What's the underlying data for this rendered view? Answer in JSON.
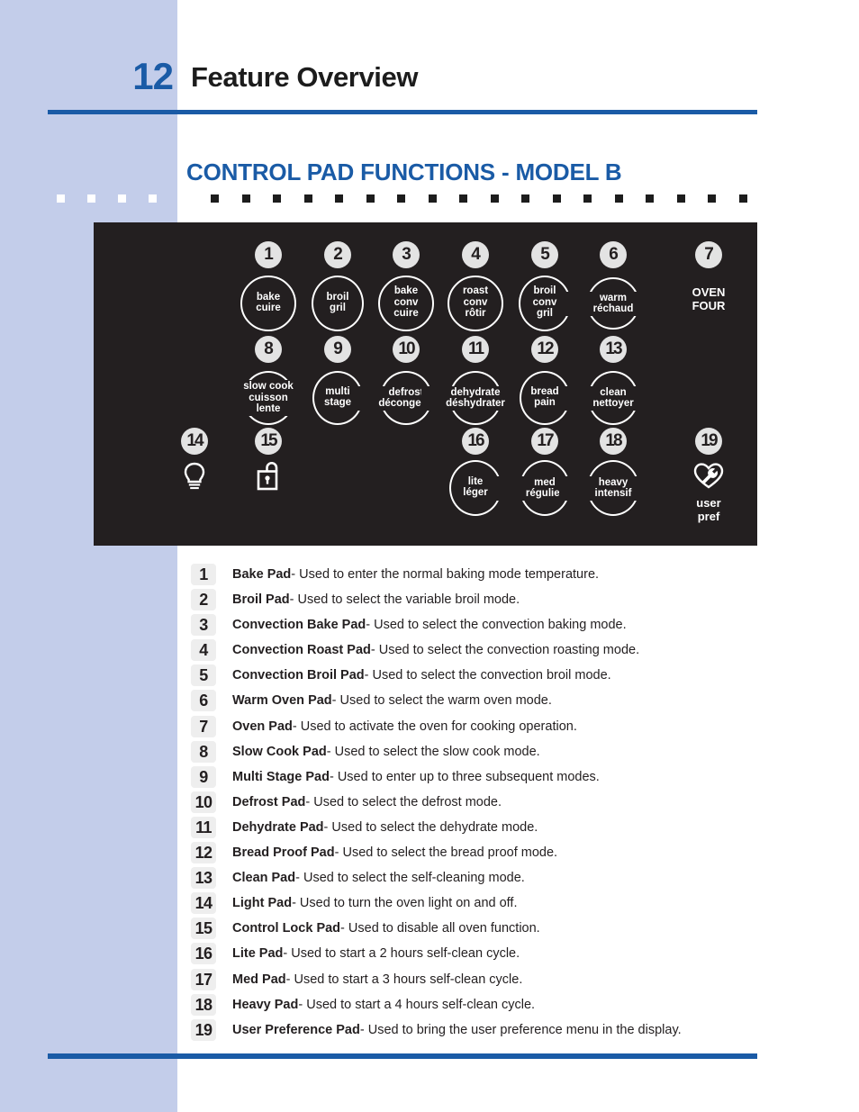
{
  "header": {
    "page_number": "12",
    "title": "Feature Overview"
  },
  "section": {
    "title": "CONTROL PAD FUNCTIONS - MODEL B"
  },
  "colors": {
    "sidebar_blue": "#c3cdea",
    "accent_blue": "#1a5ba6",
    "panel_black": "#231f20",
    "badge_gray": "#e3e3e3",
    "text_dark": "#231f20"
  },
  "control_panel": {
    "pads": [
      {
        "num": "1",
        "line1": "bake",
        "line2": "cuire",
        "line3": "",
        "shape": "circle"
      },
      {
        "num": "2",
        "line1": "broil",
        "line2": "gril",
        "line3": "",
        "shape": "circle"
      },
      {
        "num": "3",
        "line1": "bake",
        "line2": "conv",
        "line3": "cuire",
        "shape": "circle"
      },
      {
        "num": "4",
        "line1": "roast",
        "line2": "conv",
        "line3": "rôtir",
        "shape": "circle"
      },
      {
        "num": "5",
        "line1": "broil",
        "line2": "conv",
        "line3": "gril",
        "shape": "circle"
      },
      {
        "num": "6",
        "line1": "warm",
        "line2": "réchaud",
        "line3": "",
        "shape": "circle"
      },
      {
        "num": "7",
        "line1": "OVEN",
        "line2": "FOUR",
        "line3": "",
        "shape": "plain"
      },
      {
        "num": "8",
        "line1": "slow cook",
        "line2": "cuisson",
        "line3": "lente",
        "shape": "circle"
      },
      {
        "num": "9",
        "line1": "multi",
        "line2": "stage",
        "line3": "",
        "shape": "circle"
      },
      {
        "num": "10",
        "line1": "defrost",
        "line2": "décongeler",
        "line3": "",
        "shape": "circle"
      },
      {
        "num": "11",
        "line1": "dehydrate",
        "line2": "déshydrater",
        "line3": "",
        "shape": "circle"
      },
      {
        "num": "12",
        "line1": "bread",
        "line2": "pain",
        "line3": "",
        "shape": "circle"
      },
      {
        "num": "13",
        "line1": "clean",
        "line2": "nettoyer",
        "line3": "",
        "shape": "circle"
      },
      {
        "num": "14",
        "line1": "",
        "line2": "",
        "line3": "",
        "shape": "icon",
        "icon": "lightbulb-icon"
      },
      {
        "num": "15",
        "line1": "",
        "line2": "",
        "line3": "",
        "shape": "icon",
        "icon": "padlock-icon"
      },
      {
        "num": "16",
        "line1": "lite",
        "line2": "léger",
        "line3": "",
        "shape": "circle"
      },
      {
        "num": "17",
        "line1": "med",
        "line2": "régulier",
        "line3": "",
        "shape": "circle"
      },
      {
        "num": "18",
        "line1": "heavy",
        "line2": "intensif",
        "line3": "",
        "shape": "circle"
      },
      {
        "num": "19",
        "line1": "user",
        "line2": "pref",
        "line3": "",
        "shape": "icon",
        "icon": "wrench-heart-icon"
      }
    ]
  },
  "descriptions": [
    {
      "num": "1",
      "name": "Bake Pad",
      "text": "- Used to enter the normal baking mode temperature."
    },
    {
      "num": "2",
      "name": "Broil Pad",
      "text": "- Used to select the variable broil mode."
    },
    {
      "num": "3",
      "name": "Convection Bake Pad",
      "text": "- Used to select the convection baking mode."
    },
    {
      "num": "4",
      "name": "Convection Roast Pad",
      "text": "- Used to select the convection roasting mode."
    },
    {
      "num": "5",
      "name": "Convection Broil Pad",
      "text": "- Used to select the convection broil mode."
    },
    {
      "num": "6",
      "name": "Warm Oven Pad",
      "text": "- Used to select the warm oven mode."
    },
    {
      "num": "7",
      "name": "Oven Pad",
      "text": "- Used to activate the oven for cooking operation."
    },
    {
      "num": "8",
      "name": "Slow Cook Pad",
      "text": "- Used to select the slow cook mode."
    },
    {
      "num": "9",
      "name": "Multi Stage Pad",
      "text": "- Used to enter up to three subsequent modes."
    },
    {
      "num": "10",
      "name": "Defrost Pad",
      "text": "- Used to select the defrost mode."
    },
    {
      "num": "11",
      "name": "Dehydrate Pad",
      "text": "- Used to select the dehydrate mode."
    },
    {
      "num": "12",
      "name": "Bread Proof Pad",
      "text": "- Used to select the bread proof mode."
    },
    {
      "num": "13",
      "name": "Clean Pad",
      "text": "- Used to select the self-cleaning mode."
    },
    {
      "num": "14",
      "name": "Light Pad",
      "text": "- Used to turn the oven light on and off."
    },
    {
      "num": "15",
      "name": "Control Lock Pad",
      "text": "- Used to disable all oven function."
    },
    {
      "num": "16",
      "name": "Lite Pad",
      "text": "- Used to start a 2 hours self-clean cycle."
    },
    {
      "num": "17",
      "name": "Med Pad",
      "text": "- Used to start a 3 hours self-clean cycle."
    },
    {
      "num": "18",
      "name": "Heavy Pad",
      "text": "- Used to start a 4 hours self-clean cycle."
    },
    {
      "num": "19",
      "name": "User Preference Pad",
      "text": "- Used to bring the user preference menu in the display."
    }
  ]
}
